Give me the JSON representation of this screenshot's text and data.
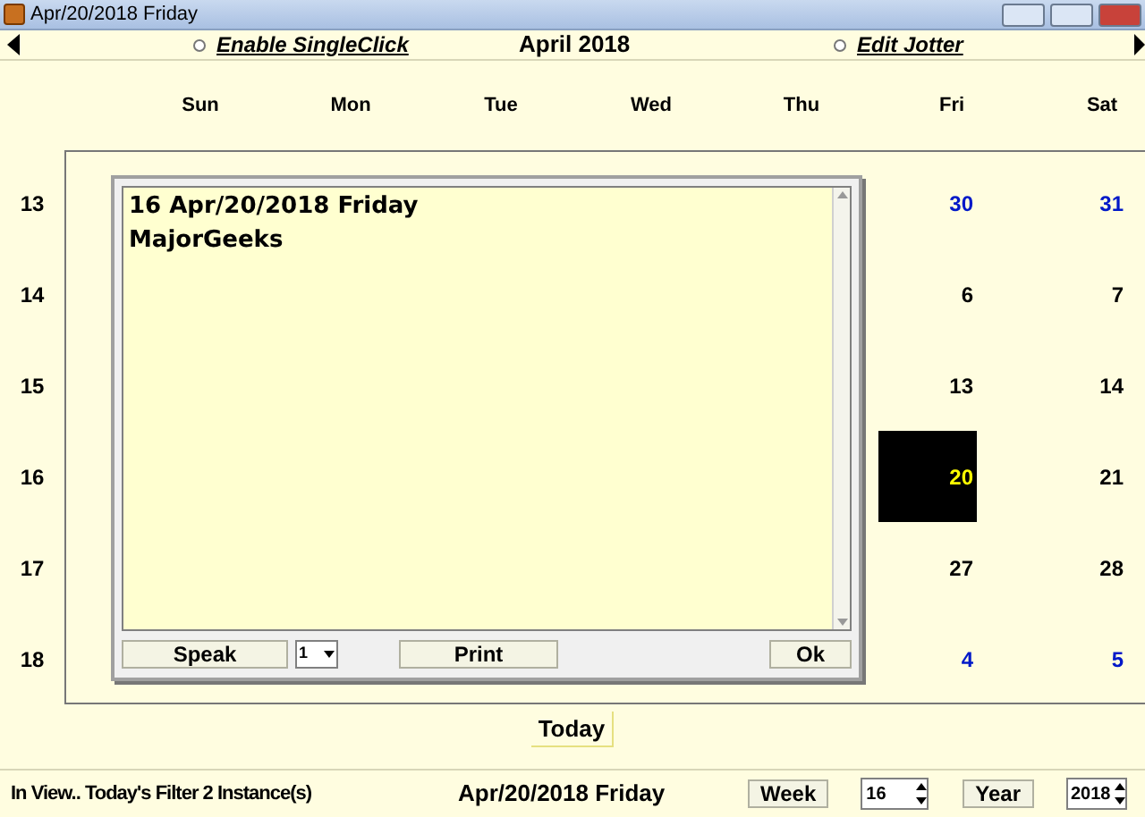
{
  "window": {
    "title": "Apr/20/2018 Friday"
  },
  "nav": {
    "month_title": "April 2018",
    "options": [
      {
        "label": "Enable SingleClick",
        "selected": false
      },
      {
        "label": "Edit Jotter",
        "selected": false
      }
    ]
  },
  "weekdays": [
    "Sun",
    "Mon",
    "Tue",
    "Wed",
    "Thu",
    "Fri",
    "Sat"
  ],
  "weeks": [
    {
      "number": "13",
      "fri": {
        "day": "30",
        "other_month": true,
        "selected": false
      },
      "sat": {
        "day": "31",
        "other_month": true,
        "selected": false
      }
    },
    {
      "number": "14",
      "fri": {
        "day": "6",
        "other_month": false,
        "selected": false
      },
      "sat": {
        "day": "7",
        "other_month": false,
        "selected": false
      }
    },
    {
      "number": "15",
      "fri": {
        "day": "13",
        "other_month": false,
        "selected": false
      },
      "sat": {
        "day": "14",
        "other_month": false,
        "selected": false
      }
    },
    {
      "number": "16",
      "fri": {
        "day": "20",
        "other_month": false,
        "selected": true
      },
      "sat": {
        "day": "21",
        "other_month": false,
        "selected": false
      }
    },
    {
      "number": "17",
      "fri": {
        "day": "27",
        "other_month": false,
        "selected": false
      },
      "sat": {
        "day": "28",
        "other_month": false,
        "selected": false
      }
    },
    {
      "number": "18",
      "fri": {
        "day": "4",
        "other_month": true,
        "selected": false
      },
      "sat": {
        "day": "5",
        "other_month": true,
        "selected": false
      }
    }
  ],
  "jotter": {
    "lines": [
      "16 Apr/20/2018 Friday",
      "MajorGeeks"
    ],
    "speak_button": "Speak",
    "voice_select": "1",
    "print_button": "Print",
    "ok_button": "Ok"
  },
  "today_button": "Today",
  "status_bar": {
    "filter_text": "In View.. Today's Filter 2  Instance(s)",
    "date": "Apr/20/2018 Friday",
    "week_button": "Week",
    "week_value": "16",
    "year_button": "Year",
    "year_value": "2018"
  }
}
